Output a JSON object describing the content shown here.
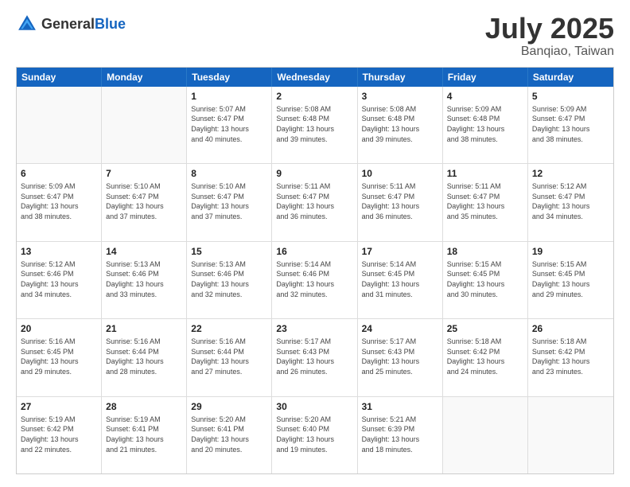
{
  "logo": {
    "general": "General",
    "blue": "Blue"
  },
  "title": {
    "month": "July 2025",
    "location": "Banqiao, Taiwan"
  },
  "calendar": {
    "headers": [
      "Sunday",
      "Monday",
      "Tuesday",
      "Wednesday",
      "Thursday",
      "Friday",
      "Saturday"
    ],
    "rows": [
      [
        {
          "day": "",
          "info": "",
          "empty": true
        },
        {
          "day": "",
          "info": "",
          "empty": true
        },
        {
          "day": "1",
          "info": "Sunrise: 5:07 AM\nSunset: 6:47 PM\nDaylight: 13 hours\nand 40 minutes."
        },
        {
          "day": "2",
          "info": "Sunrise: 5:08 AM\nSunset: 6:48 PM\nDaylight: 13 hours\nand 39 minutes."
        },
        {
          "day": "3",
          "info": "Sunrise: 5:08 AM\nSunset: 6:48 PM\nDaylight: 13 hours\nand 39 minutes."
        },
        {
          "day": "4",
          "info": "Sunrise: 5:09 AM\nSunset: 6:48 PM\nDaylight: 13 hours\nand 38 minutes."
        },
        {
          "day": "5",
          "info": "Sunrise: 5:09 AM\nSunset: 6:47 PM\nDaylight: 13 hours\nand 38 minutes."
        }
      ],
      [
        {
          "day": "6",
          "info": "Sunrise: 5:09 AM\nSunset: 6:47 PM\nDaylight: 13 hours\nand 38 minutes."
        },
        {
          "day": "7",
          "info": "Sunrise: 5:10 AM\nSunset: 6:47 PM\nDaylight: 13 hours\nand 37 minutes."
        },
        {
          "day": "8",
          "info": "Sunrise: 5:10 AM\nSunset: 6:47 PM\nDaylight: 13 hours\nand 37 minutes."
        },
        {
          "day": "9",
          "info": "Sunrise: 5:11 AM\nSunset: 6:47 PM\nDaylight: 13 hours\nand 36 minutes."
        },
        {
          "day": "10",
          "info": "Sunrise: 5:11 AM\nSunset: 6:47 PM\nDaylight: 13 hours\nand 36 minutes."
        },
        {
          "day": "11",
          "info": "Sunrise: 5:11 AM\nSunset: 6:47 PM\nDaylight: 13 hours\nand 35 minutes."
        },
        {
          "day": "12",
          "info": "Sunrise: 5:12 AM\nSunset: 6:47 PM\nDaylight: 13 hours\nand 34 minutes."
        }
      ],
      [
        {
          "day": "13",
          "info": "Sunrise: 5:12 AM\nSunset: 6:46 PM\nDaylight: 13 hours\nand 34 minutes."
        },
        {
          "day": "14",
          "info": "Sunrise: 5:13 AM\nSunset: 6:46 PM\nDaylight: 13 hours\nand 33 minutes."
        },
        {
          "day": "15",
          "info": "Sunrise: 5:13 AM\nSunset: 6:46 PM\nDaylight: 13 hours\nand 32 minutes."
        },
        {
          "day": "16",
          "info": "Sunrise: 5:14 AM\nSunset: 6:46 PM\nDaylight: 13 hours\nand 32 minutes."
        },
        {
          "day": "17",
          "info": "Sunrise: 5:14 AM\nSunset: 6:45 PM\nDaylight: 13 hours\nand 31 minutes."
        },
        {
          "day": "18",
          "info": "Sunrise: 5:15 AM\nSunset: 6:45 PM\nDaylight: 13 hours\nand 30 minutes."
        },
        {
          "day": "19",
          "info": "Sunrise: 5:15 AM\nSunset: 6:45 PM\nDaylight: 13 hours\nand 29 minutes."
        }
      ],
      [
        {
          "day": "20",
          "info": "Sunrise: 5:16 AM\nSunset: 6:45 PM\nDaylight: 13 hours\nand 29 minutes."
        },
        {
          "day": "21",
          "info": "Sunrise: 5:16 AM\nSunset: 6:44 PM\nDaylight: 13 hours\nand 28 minutes."
        },
        {
          "day": "22",
          "info": "Sunrise: 5:16 AM\nSunset: 6:44 PM\nDaylight: 13 hours\nand 27 minutes."
        },
        {
          "day": "23",
          "info": "Sunrise: 5:17 AM\nSunset: 6:43 PM\nDaylight: 13 hours\nand 26 minutes."
        },
        {
          "day": "24",
          "info": "Sunrise: 5:17 AM\nSunset: 6:43 PM\nDaylight: 13 hours\nand 25 minutes."
        },
        {
          "day": "25",
          "info": "Sunrise: 5:18 AM\nSunset: 6:42 PM\nDaylight: 13 hours\nand 24 minutes."
        },
        {
          "day": "26",
          "info": "Sunrise: 5:18 AM\nSunset: 6:42 PM\nDaylight: 13 hours\nand 23 minutes."
        }
      ],
      [
        {
          "day": "27",
          "info": "Sunrise: 5:19 AM\nSunset: 6:42 PM\nDaylight: 13 hours\nand 22 minutes."
        },
        {
          "day": "28",
          "info": "Sunrise: 5:19 AM\nSunset: 6:41 PM\nDaylight: 13 hours\nand 21 minutes."
        },
        {
          "day": "29",
          "info": "Sunrise: 5:20 AM\nSunset: 6:41 PM\nDaylight: 13 hours\nand 20 minutes."
        },
        {
          "day": "30",
          "info": "Sunrise: 5:20 AM\nSunset: 6:40 PM\nDaylight: 13 hours\nand 19 minutes."
        },
        {
          "day": "31",
          "info": "Sunrise: 5:21 AM\nSunset: 6:39 PM\nDaylight: 13 hours\nand 18 minutes."
        },
        {
          "day": "",
          "info": "",
          "empty": true
        },
        {
          "day": "",
          "info": "",
          "empty": true
        }
      ]
    ]
  }
}
